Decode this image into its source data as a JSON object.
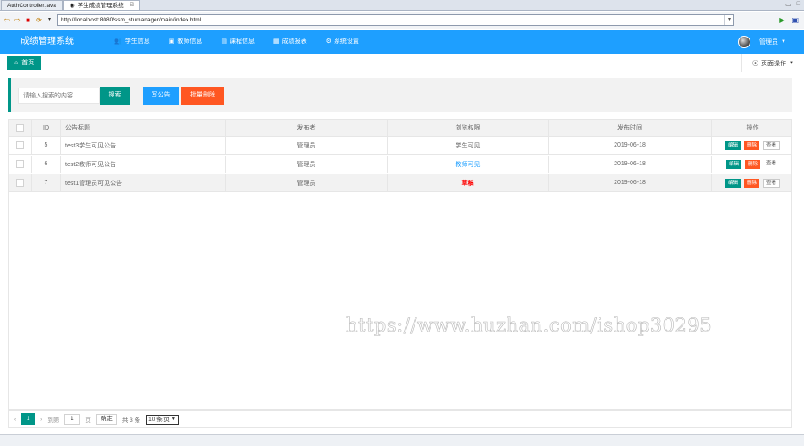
{
  "ide": {
    "tab1": "AuthController.java",
    "tab2": "学生成绩管理系统",
    "close": "☒"
  },
  "browser": {
    "url": "http://localhost:8080/ssm_stumanager/main/index.html"
  },
  "header": {
    "brand": "成绩管理系统",
    "nav": [
      "学生信息",
      "教师信息",
      "课程信息",
      "成绩报表",
      "系统设置"
    ],
    "user": "管理员"
  },
  "tabs": {
    "home": "首页",
    "page_ops": "页面操作"
  },
  "toolbar": {
    "search_placeholder": "请输入搜索的内容",
    "search_btn": "搜索",
    "write_btn": "写公告",
    "batch_btn": "批量删除"
  },
  "table": {
    "headers": [
      "ID",
      "公告标题",
      "发布者",
      "浏览权限",
      "发布时间",
      "操作"
    ],
    "rows": [
      {
        "id": "5",
        "title": "test3学生可见公告",
        "publisher": "管理员",
        "perm": "学生可见",
        "date": "2019-06-18"
      },
      {
        "id": "6",
        "title": "test2教师可见公告",
        "publisher": "管理员",
        "perm": "教师可见",
        "date": "2019-06-18"
      },
      {
        "id": "7",
        "title": "test1管理员可见公告",
        "publisher": "管理员",
        "perm": "草稿",
        "date": "2019-06-18"
      }
    ],
    "ops": {
      "edit": "编辑",
      "del": "删除",
      "view": "查看"
    }
  },
  "pager": {
    "page": "1",
    "to": "到第",
    "page_input": "1",
    "page_unit": "页",
    "go": "确定",
    "total": "共 3 条",
    "per_page": "10 条/页"
  },
  "watermark": "https://www.huzhan.com/ishop30295",
  "colors": {
    "primary": "#1e9fff",
    "green": "#009688",
    "orange": "#ff5722"
  }
}
